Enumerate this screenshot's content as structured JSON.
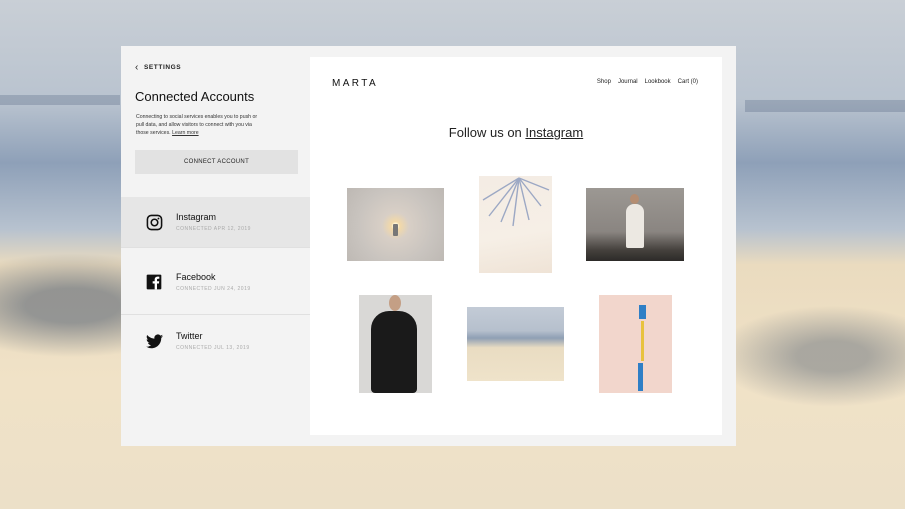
{
  "sidebar": {
    "back_label": "SETTINGS",
    "title": "Connected Accounts",
    "description": "Connecting to social services enables you to push or pull data, and allow visitors to connect with you via those services.",
    "learn_more": "Learn more",
    "connect_button": "CONNECT ACCOUNT",
    "accounts": [
      {
        "name": "Instagram",
        "date": "CONNECTED APR 12, 2019",
        "icon": "instagram-icon"
      },
      {
        "name": "Facebook",
        "date": "CONNECTED JUN 24, 2019",
        "icon": "facebook-icon"
      },
      {
        "name": "Twitter",
        "date": "CONNECTED JUL 13, 2019",
        "icon": "twitter-icon"
      }
    ]
  },
  "preview": {
    "logo": "MARTA",
    "nav": [
      "Shop",
      "Journal",
      "Lookbook",
      "Cart (0)"
    ],
    "follow_prefix": "Follow us on ",
    "follow_link": "Instagram"
  },
  "colors": {
    "panel_bg": "#f3f3f3",
    "active_row": "#e6e6e6",
    "button_bg": "#e2e2e2"
  }
}
